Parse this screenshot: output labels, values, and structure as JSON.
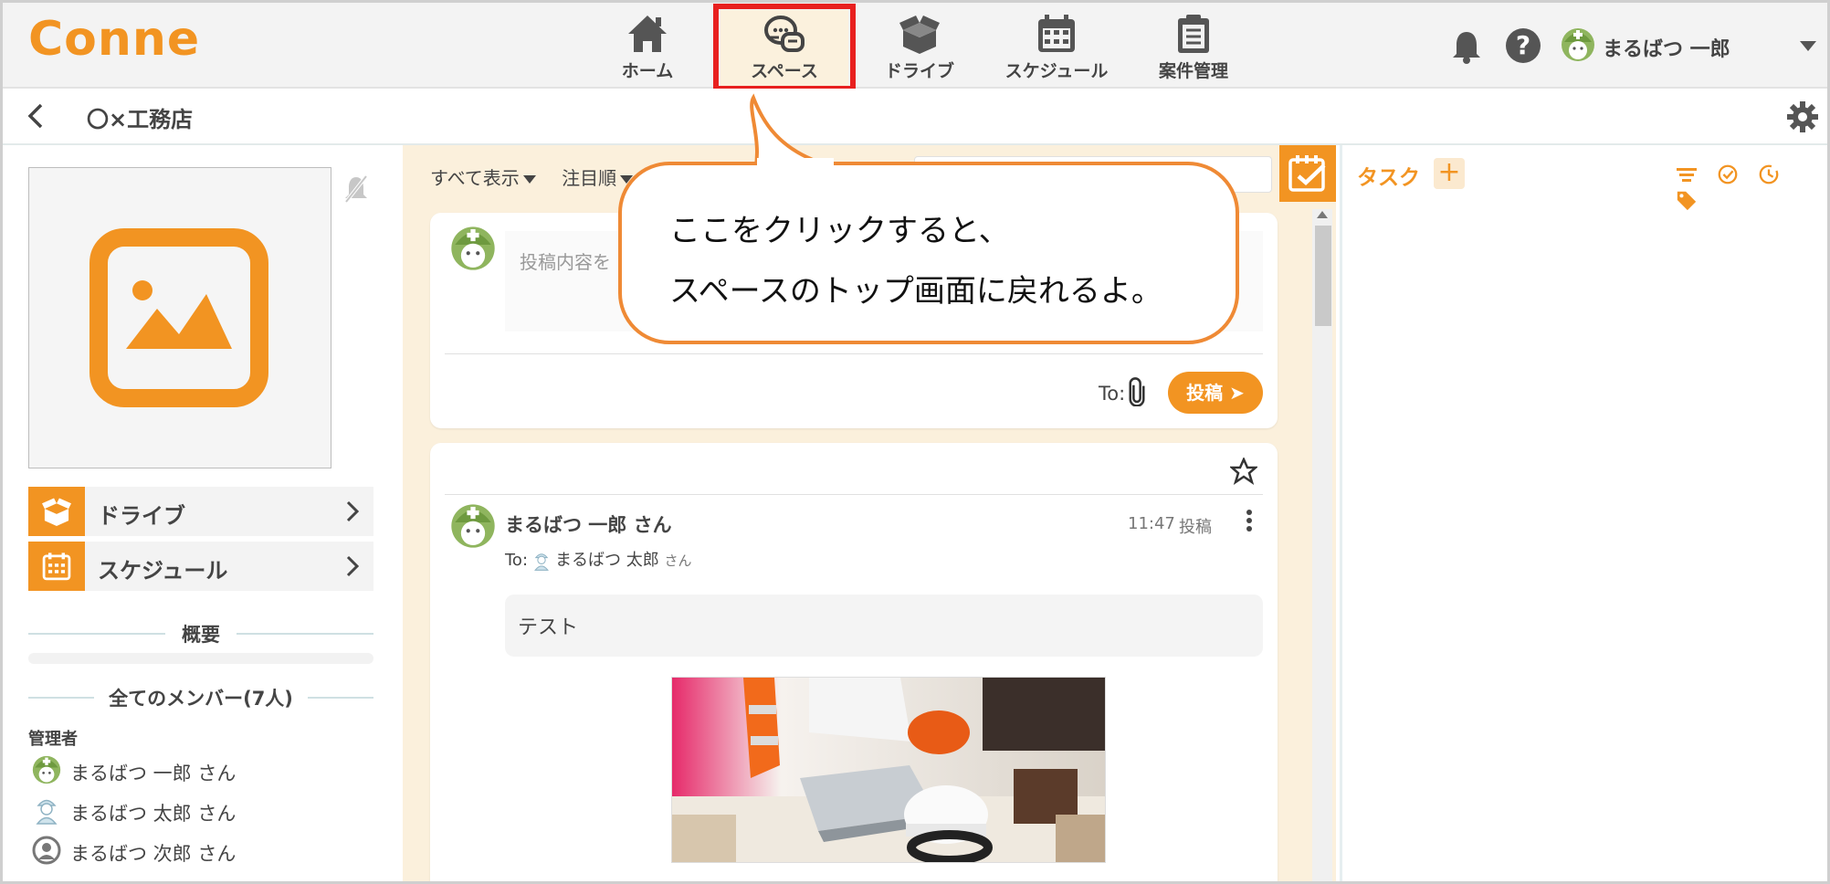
{
  "app": {
    "logo": "Conne"
  },
  "nav": {
    "items": [
      {
        "label": "ホーム",
        "icon": "home-icon"
      },
      {
        "label": "スペース",
        "icon": "chat-bubbles-icon",
        "active": true
      },
      {
        "label": "ドライブ",
        "icon": "box-icon"
      },
      {
        "label": "スケジュール",
        "icon": "calendar-icon"
      },
      {
        "label": "案件管理",
        "icon": "clipboard-icon"
      }
    ],
    "user_name": "まるばつ 一郎",
    "highlight_color": "#e8201f"
  },
  "subheader": {
    "space_name": "〇×工務店"
  },
  "left": {
    "links": [
      {
        "label": "ドライブ",
        "icon": "box-icon"
      },
      {
        "label": "スケジュール",
        "icon": "calendar-icon"
      }
    ],
    "overview_title": "概要",
    "members_title": "全てのメンバー(7人)",
    "role_label": "管理者",
    "members": [
      {
        "name": "まるばつ 一郎 さん",
        "icon": "helmet-avatar-icon"
      },
      {
        "name": "まるばつ 太郎 さん",
        "icon": "worker-avatar-icon"
      },
      {
        "name": "まるばつ 次郎 さん",
        "icon": "default-avatar-icon"
      }
    ]
  },
  "feed": {
    "filter_all": "すべて表示",
    "filter_sort": "注目順",
    "compose": {
      "placeholder": "投稿内容を",
      "to_label": "To:",
      "post_label": "投稿"
    },
    "post": {
      "author": "まるばつ 一郎 さん",
      "time": "11:47",
      "status": "投稿",
      "to_label": "To:",
      "to_name": "まるばつ 太郎",
      "to_suffix": "さん",
      "body": "テスト"
    }
  },
  "tasks": {
    "title": "タスク",
    "add_label": "+"
  },
  "callout": {
    "line1": "ここをクリックすると、",
    "line2": "スペースのトップ画面に戻れるよ。",
    "border_color": "#ef8a35"
  },
  "colors": {
    "accent": "#f29422",
    "feed_bg": "#fbf0dc"
  }
}
